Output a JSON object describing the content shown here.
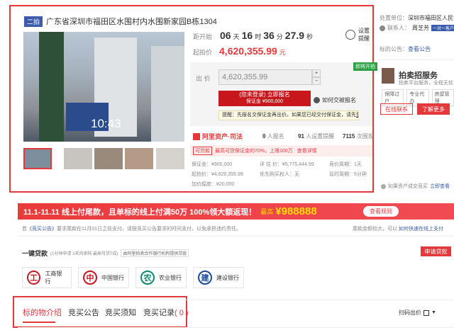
{
  "item": {
    "badge": "二拍",
    "title": "广东省深圳市福田区水围村内水围新家园B栋1304"
  },
  "timer": {
    "label": "距开始",
    "days": "06",
    "d_unit": "天",
    "hours": "16",
    "h_unit": "时",
    "mins": "36",
    "m_unit": "分",
    "secs": "27.9",
    "s_unit": "秒",
    "remind_line1": "设置",
    "remind_line2": "提醒"
  },
  "price": {
    "start_label": "起拍价",
    "start_value": "4,620,355.99",
    "unit": "元"
  },
  "photo": {
    "time_overlay": "10:43"
  },
  "bid": {
    "corner_badge": "即将开拍",
    "label": "出  价",
    "input_value": "4,620,355.99",
    "button_line1": "(您未登录) 立即报名",
    "button_line2": "保证金 ¥900,000",
    "help_link": "如何交被报名",
    "notice_text": "提醒：先报名交保证金再出价。如果您已经交付保证金，请先",
    "notice_login": "登录"
  },
  "platform": {
    "brand": "阿里资产·司法",
    "signup_count": "0",
    "signup_label": "人报名",
    "remind_count": "91",
    "remind_label": "人设置提醒",
    "view_count": "7115",
    "view_label": "次围观"
  },
  "loan": {
    "badge": "可贷款",
    "text": "最高可贷保证金的70%，上限100万",
    "link": "查看详情"
  },
  "details": {
    "deposit": "保证金：¥900,000",
    "assess": "评 估 价：¥5,775,444.99",
    "cycle": "竞价周期：1天",
    "start_price": "起拍价：¥4,620,355.99",
    "priority": "优先购买权人：无",
    "delay": "延时周期：5分钟",
    "step": "加价幅度：¥20,000"
  },
  "court": {
    "label": "处置单位：",
    "name": "深圳市福田区人民法院",
    "contact_label": "联系人：",
    "contact_name": "周芝芳",
    "contact_extra": "一对一客户服务",
    "supervisor_label": "标的公告：",
    "supervisor_link": "查看公告",
    "service_title": "拍卖招服务",
    "service_sub": "拍卖平台服务，全程无忧",
    "tags": [
      "保障过户",
      "专业代办",
      "房屋管理"
    ],
    "btn_contact": "在线联系",
    "btn_more": "了解更多"
  },
  "sidebar_link": {
    "prefix": "如果资产成交竞买",
    "link": "立即查看"
  },
  "promo": {
    "text": "11.1-11.11 线上付尾款，且单标的线上付满50万 100%领大额返现！",
    "max_label": "最高",
    "amount": "¥988888",
    "button": "查看规则"
  },
  "notice": {
    "prefix": "若",
    "link": "《竞买公告》",
    "text": "要求尾款在11月01日之前支付，请按竞买公告要求的时间支付，以免承担违约责任。",
    "right1": "尾款金额较大，可以",
    "right2": "如何快速在线上支付"
  },
  "one_loan": {
    "title": "一键贷款",
    "sub": "(1分钟申请 2天内审核 最高可贷7成)",
    "link": "由阿里拍卖合作银行机构提供贷款",
    "button": "申请贷款"
  },
  "banks": [
    "工商银行",
    "中国银行",
    "农业银行",
    "建设银行"
  ],
  "tabs": [
    {
      "label": "标的物介绍"
    },
    {
      "label": "竞买公告"
    },
    {
      "label": "竞买须知"
    },
    {
      "label": "竞买记录",
      "count": "( 0 )"
    }
  ],
  "scan": {
    "label": "扫码出价"
  },
  "colors": {
    "accent": "#e4393c",
    "promo_bg": "#e4393c",
    "promo_amount": "#ffde00"
  }
}
